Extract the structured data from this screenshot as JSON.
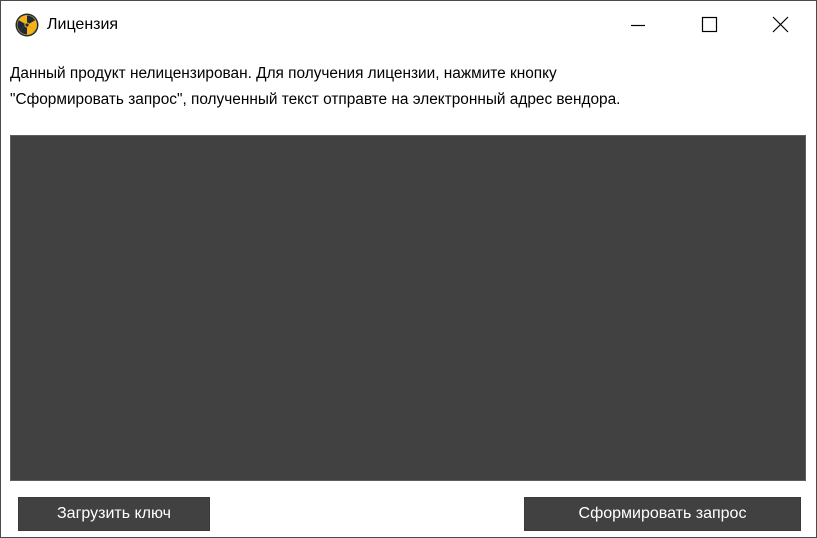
{
  "window": {
    "title": "Лицензия",
    "icon": "radiation-icon",
    "controls": [
      "minimize-icon",
      "maximize-icon",
      "close-icon"
    ]
  },
  "description": {
    "line1": "Данный продукт нелицензирован. Для получения лицензии, нажмите кнопку",
    "line2": "\"Сформировать запрос\", полученный текст отправте на электронный адрес вендора."
  },
  "request_text": {
    "value": ""
  },
  "buttons": {
    "load_key": "Загрузить ключ",
    "generate_request": "Сформировать запрос"
  },
  "colors": {
    "textarea_bg": "#414141",
    "button_bg": "#414141",
    "button_text": "#ffffff",
    "icon_primary": "#f5b318",
    "icon_dark": "#1e2a3a"
  }
}
